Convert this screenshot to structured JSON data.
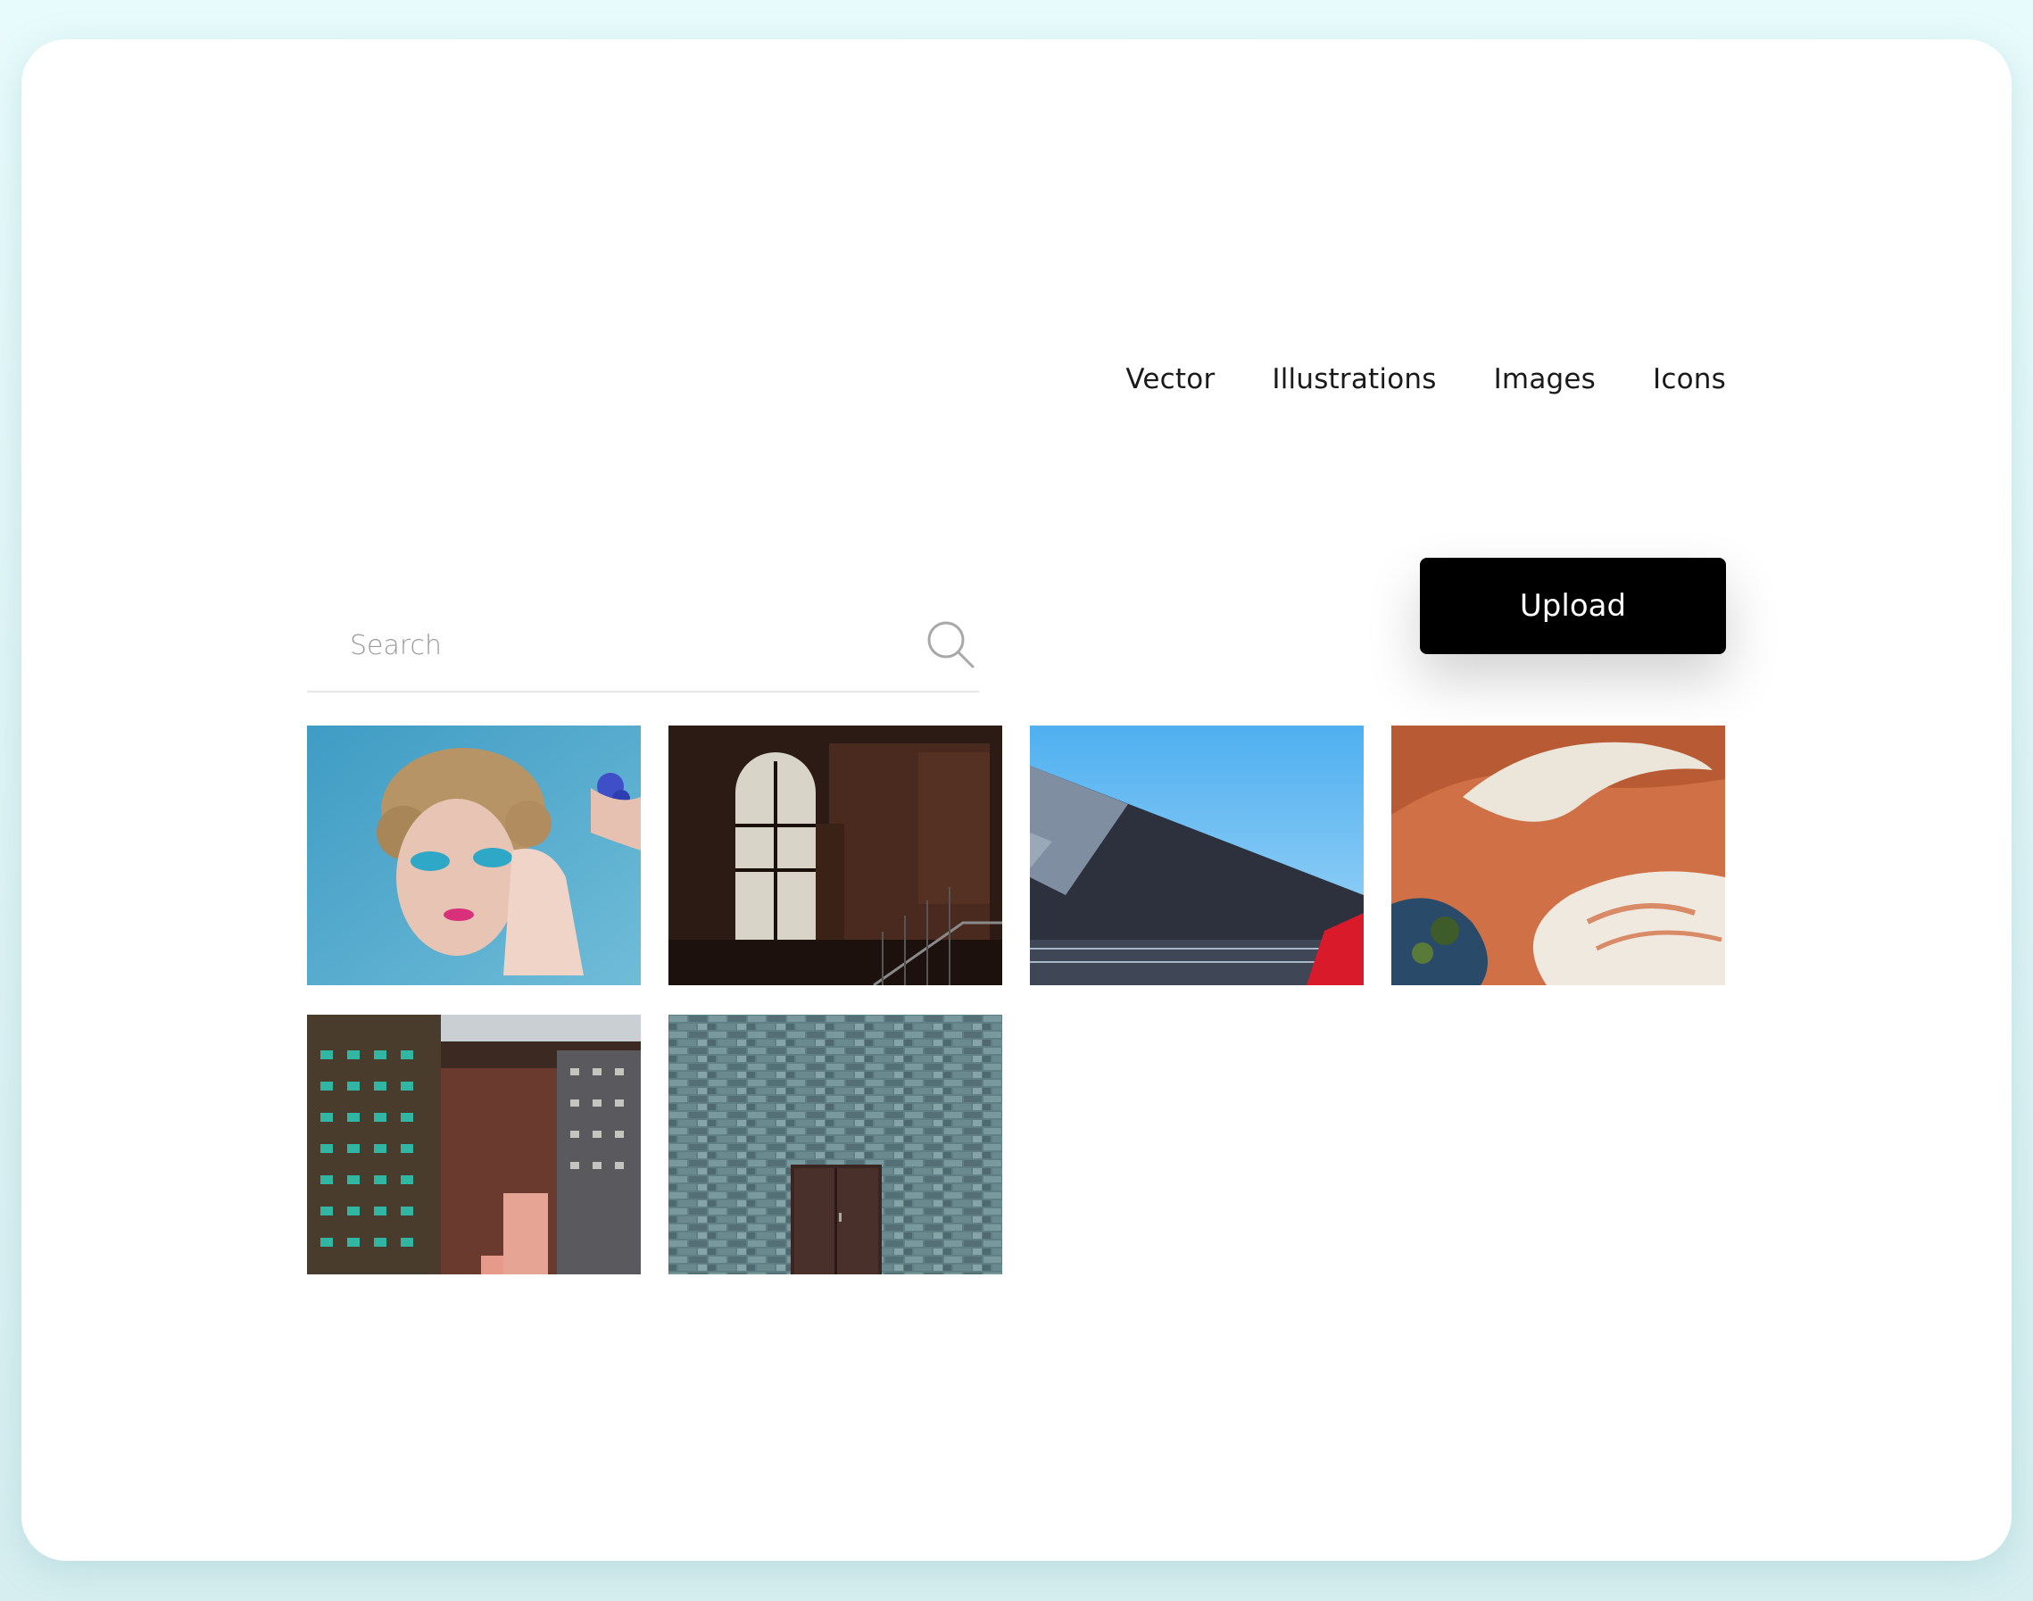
{
  "nav": {
    "items": [
      {
        "label": "Vector"
      },
      {
        "label": "Illustrations"
      },
      {
        "label": "Images"
      },
      {
        "label": "Icons"
      }
    ]
  },
  "search": {
    "placeholder": "Search",
    "value": "",
    "icon": "search-icon"
  },
  "upload": {
    "label": "Upload"
  },
  "gallery": {
    "images": [
      {
        "subject": "woman with blue eye makeup"
      },
      {
        "subject": "dark room with arched window"
      },
      {
        "subject": "modern building roof against blue sky"
      },
      {
        "subject": "aerial abstract orange landscape"
      },
      {
        "subject": "dense high-rise apartment buildings"
      },
      {
        "subject": "gray stone wall with brown door"
      }
    ]
  },
  "colors": {
    "page_background": "#e6f9fb",
    "card_background": "#ffffff",
    "button_background": "#000000",
    "button_text": "#ffffff"
  }
}
